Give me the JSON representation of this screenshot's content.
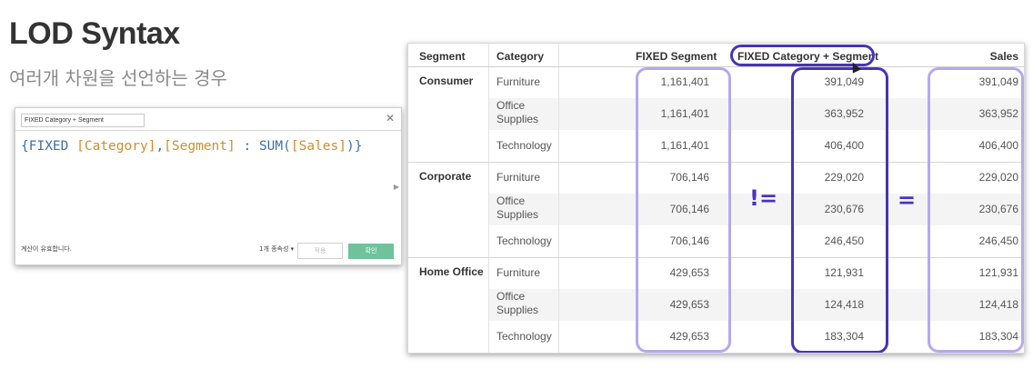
{
  "slide": {
    "title": "LOD Syntax",
    "subtitle": "여러개 차원을 선언하는 경우"
  },
  "dialog": {
    "calc_name": "FIXED Category + Segment",
    "close_icon": "close-icon",
    "formula": {
      "open": "{",
      "keyword": "FIXED",
      "field1": "[Category]",
      "comma": ",",
      "field2": "[Segment]",
      "colon": " : ",
      "func": "SUM(",
      "field3": "[Sales]",
      "close": ")}"
    },
    "status": "계산이 유효합니다.",
    "dependencies": "1개 종속성 ▾",
    "apply_label": "적용",
    "ok_label": "확인"
  },
  "table": {
    "headers": {
      "segment": "Segment",
      "category": "Category",
      "fixed_segment": "FIXED Segment",
      "fixed_cat_seg": "FIXED Category + Segment",
      "sales": "Sales"
    },
    "groups": [
      {
        "segment": "Consumer",
        "rows": [
          {
            "category": "Furniture",
            "fixed_segment": "1,161,401",
            "fixed_cat_seg": "391,049",
            "sales": "391,049"
          },
          {
            "category": "Office Supplies",
            "fixed_segment": "1,161,401",
            "fixed_cat_seg": "363,952",
            "sales": "363,952"
          },
          {
            "category": "Technology",
            "fixed_segment": "1,161,401",
            "fixed_cat_seg": "406,400",
            "sales": "406,400"
          }
        ]
      },
      {
        "segment": "Corporate",
        "rows": [
          {
            "category": "Furniture",
            "fixed_segment": "706,146",
            "fixed_cat_seg": "229,020",
            "sales": "229,020"
          },
          {
            "category": "Office Supplies",
            "fixed_segment": "706,146",
            "fixed_cat_seg": "230,676",
            "sales": "230,676"
          },
          {
            "category": "Technology",
            "fixed_segment": "706,146",
            "fixed_cat_seg": "246,450",
            "sales": "246,450"
          }
        ]
      },
      {
        "segment": "Home Office",
        "rows": [
          {
            "category": "Furniture",
            "fixed_segment": "429,653",
            "fixed_cat_seg": "121,931",
            "sales": "121,931"
          },
          {
            "category": "Office Supplies",
            "fixed_segment": "429,653",
            "fixed_cat_seg": "124,418",
            "sales": "124,418"
          },
          {
            "category": "Technology",
            "fixed_segment": "429,653",
            "fixed_cat_seg": "183,304",
            "sales": "183,304"
          }
        ]
      }
    ]
  },
  "annotations": {
    "not_equal": "!=",
    "equal": "="
  },
  "colors": {
    "highlight_dark": "#4733b8",
    "highlight_light": "#b4a9ee",
    "ok_button": "#6fc29b",
    "formula_keyword": "#3f6fae",
    "formula_field": "#d28b2e"
  }
}
